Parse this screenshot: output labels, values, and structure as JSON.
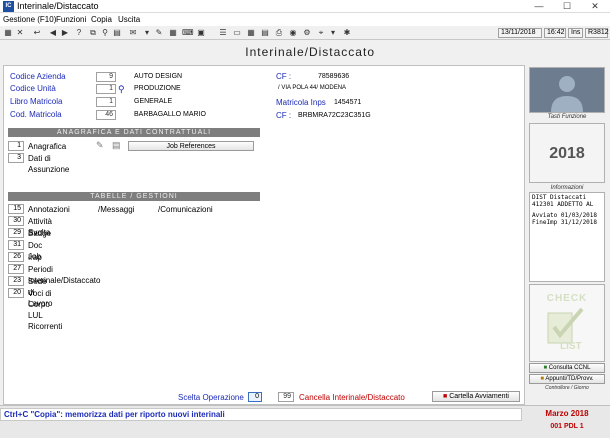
{
  "window": {
    "title": "Interinale/Distaccato",
    "app_icon": "IC"
  },
  "menu": [
    "Gestione (F10)",
    "Funzioni",
    "Copia",
    "Uscita"
  ],
  "toolbar": {
    "date": "13/11/2018",
    "time": "16:42",
    "ins": "Ins",
    "version": "R3812"
  },
  "page_title": "Interinale/Distaccato",
  "fields": {
    "codice_azienda": {
      "label": "Codice Azienda",
      "num": "9",
      "value": "AUTO DESIGN"
    },
    "codice_unita": {
      "label": "Codice Unità",
      "num": "1",
      "value": "PRODUZIONE"
    },
    "libro_matricola": {
      "label": "Libro Matricola",
      "num": "1",
      "value": "GENERALE"
    },
    "cod_matricola": {
      "label": "Cod. Matricola",
      "num": "46",
      "value": "BARBAGALLO MARIO"
    },
    "cf_company": {
      "label": "CF :",
      "value": "78589636"
    },
    "address": {
      "value": "/ VIA POLA 44/ MODENA"
    },
    "matricola_inps": {
      "label": "Matricola Inps",
      "value": "1454571"
    },
    "cf_person": {
      "label": "CF :",
      "value": "BRBMRA72C23C351G"
    }
  },
  "sections": {
    "anagrafica_title": "ANAGRAFICA E DATI CONTRATTUALI",
    "anagrafica": [
      {
        "num": "1",
        "label": "Anagrafica"
      },
      {
        "num": "3",
        "label": "Dati di Assunzione"
      }
    ],
    "job_references": "Job References",
    "tabelle_title": "TABELLE / GESTIONI",
    "tabelle": [
      {
        "num": "15",
        "label": "Annotazioni"
      },
      {
        "num": "30",
        "label": "Attività Svolta"
      },
      {
        "num": "29",
        "label": "Badge"
      },
      {
        "num": "31",
        "label": "Doc Job"
      },
      {
        "num": "26",
        "label": "Irap"
      },
      {
        "num": "27",
        "label": "Periodi Interinale/Distaccato"
      },
      {
        "num": "23",
        "label": "Sede di Lavoro"
      },
      {
        "num": "20",
        "label": "Voci di Corpo LUL Ricorrenti"
      }
    ],
    "messaggi": "/Messaggi",
    "comunicazioni": "/Comunicazioni"
  },
  "bottom": {
    "scelta_label": "Scelta Operazione",
    "scelta_value": "0",
    "cancella_num": "99",
    "cancella_label": "Cancella Interinale/Distaccato",
    "cartella_label": "Cartella Avviamenti"
  },
  "sidebar": {
    "tasti_funzione": "Tasti Funzione",
    "year": "2018",
    "informazioni": "Informazioni",
    "info_lines": [
      "DIST   Distaccati",
      "412301 ADDETTO AL",
      "Avviato 01/03/2018",
      "FineImp 31/12/2018"
    ],
    "check_list_top": "CHECK",
    "check_list_bottom": "LIST",
    "consulta_ccnl": "Consulta CCNL",
    "appunti": "Appunti/TD/Provv.",
    "controllore": "Controllore / Giorno"
  },
  "status": {
    "message": "Ctrl+C \"Copia\": memorizza dati per riporto nuovi interinali",
    "period": "Marzo    2018",
    "pdl": "001 PDL 1"
  }
}
